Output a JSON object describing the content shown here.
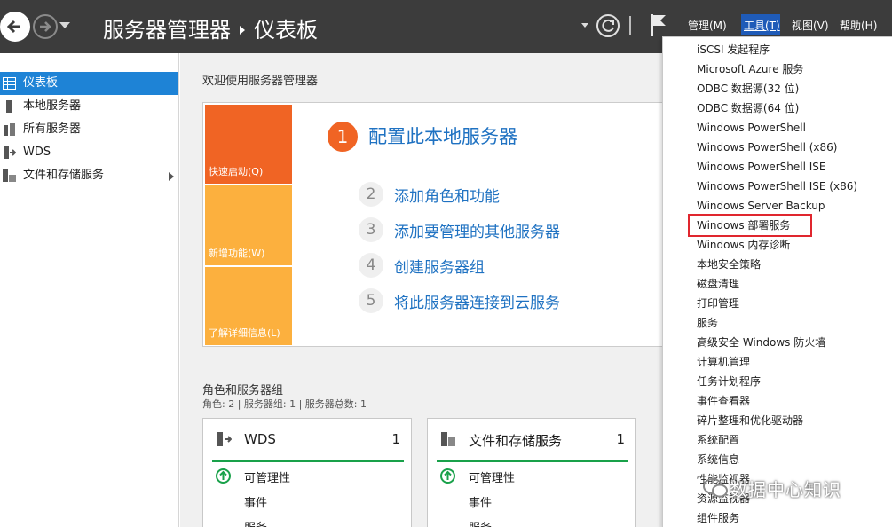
{
  "header": {
    "breadcrumb_root": "服务器管理器",
    "breadcrumb_page": "仪表板",
    "menus": {
      "manage": "管理(M)",
      "tools": "工具(T)",
      "view": "视图(V)",
      "help": "帮助(H)"
    }
  },
  "sidebar": {
    "items": [
      {
        "label": "仪表板",
        "icon": "dashboard-icon"
      },
      {
        "label": "本地服务器",
        "icon": "server-icon"
      },
      {
        "label": "所有服务器",
        "icon": "servers-icon"
      },
      {
        "label": "WDS",
        "icon": "wds-icon"
      },
      {
        "label": "文件和存储服务",
        "icon": "storage-icon"
      }
    ]
  },
  "welcome": {
    "title": "欢迎使用服务器管理器",
    "tiles": [
      "快速启动(Q)",
      "新增功能(W)",
      "了解详细信息(L)"
    ],
    "steps": [
      {
        "num": "1",
        "text": "配置此本地服务器"
      },
      {
        "num": "2",
        "text": "添加角色和功能"
      },
      {
        "num": "3",
        "text": "添加要管理的其他服务器"
      },
      {
        "num": "4",
        "text": "创建服务器组"
      },
      {
        "num": "5",
        "text": "将此服务器连接到云服务"
      }
    ]
  },
  "roles": {
    "title": "角色和服务器组",
    "subtitle": "角色: 2 | 服务器组: 1 | 服务器总数: 1",
    "cards": [
      {
        "title": "WDS",
        "count": "1",
        "rows": [
          "可管理性",
          "事件",
          "服务"
        ]
      },
      {
        "title": "文件和存储服务",
        "count": "1",
        "rows": [
          "可管理性",
          "事件",
          "服务"
        ]
      }
    ]
  },
  "tools_menu": {
    "items": [
      "iSCSI 发起程序",
      "Microsoft Azure 服务",
      "ODBC 数据源(32 位)",
      "ODBC 数据源(64 位)",
      "Windows PowerShell",
      "Windows PowerShell (x86)",
      "Windows PowerShell ISE",
      "Windows PowerShell ISE (x86)",
      "Windows Server Backup",
      "Windows 部署服务",
      "Windows 内存诊断",
      "本地安全策略",
      "磁盘清理",
      "打印管理",
      "服务",
      "高级安全 Windows 防火墙",
      "计算机管理",
      "任务计划程序",
      "事件查看器",
      "碎片整理和优化驱动器",
      "系统配置",
      "系统信息",
      "性能监视器",
      "资源监视器",
      "组件服务"
    ],
    "highlighted_index": 9,
    "highlight_color": "#e0262e"
  },
  "watermark": {
    "text": "数据中心知识"
  }
}
